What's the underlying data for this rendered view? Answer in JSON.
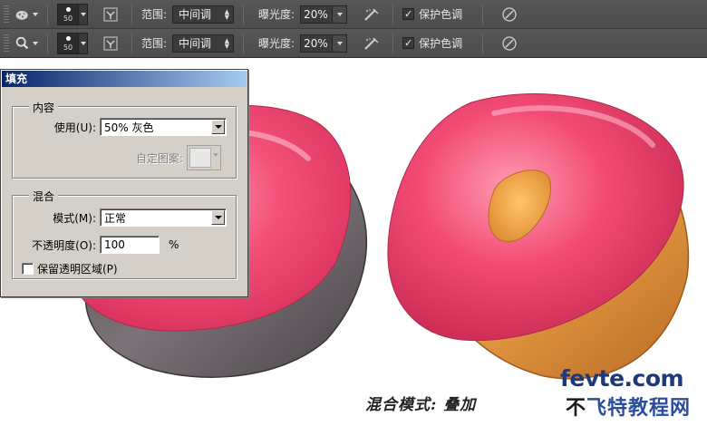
{
  "toolbar_rows": [
    {
      "tool_icon": "sponge-icon",
      "brush_size": "50",
      "range_label": "范围:",
      "range_value": "中间调",
      "exposure_label": "曝光度:",
      "exposure_value": "20%",
      "protect_label": "保护色调",
      "protect_checked": true
    },
    {
      "tool_icon": "zoom-icon",
      "brush_size": "50",
      "range_label": "范围:",
      "range_value": "中间调",
      "exposure_label": "曝光度:",
      "exposure_value": "20%",
      "protect_label": "保护色调",
      "protect_checked": true
    }
  ],
  "dialog": {
    "title": "填充",
    "content_group": {
      "legend": "内容",
      "use_label": "使用(U):",
      "use_value": "50% 灰色",
      "custom_pattern_label": "自定图案:"
    },
    "blend_group": {
      "legend": "混合",
      "mode_label": "模式(M):",
      "mode_value": "正常",
      "opacity_label": "不透明度(O):",
      "opacity_value": "100",
      "opacity_unit": "%",
      "preserve_label": "保留透明区域(P)",
      "preserve_checked": false
    }
  },
  "caption": "混合模式: 叠加",
  "watermark": {
    "site": "fevte.com",
    "name_prefix": "不",
    "name_rest": "飞特教程网"
  },
  "colors": {
    "toolbar_bg": "#4f4f4f",
    "icing_pink": "#f0486e",
    "dough": "#e7a048",
    "gray_dough": "#6b6469",
    "dialog_bg": "#d4d0c8",
    "title_start": "#0a246a",
    "title_end": "#a6caf0"
  }
}
